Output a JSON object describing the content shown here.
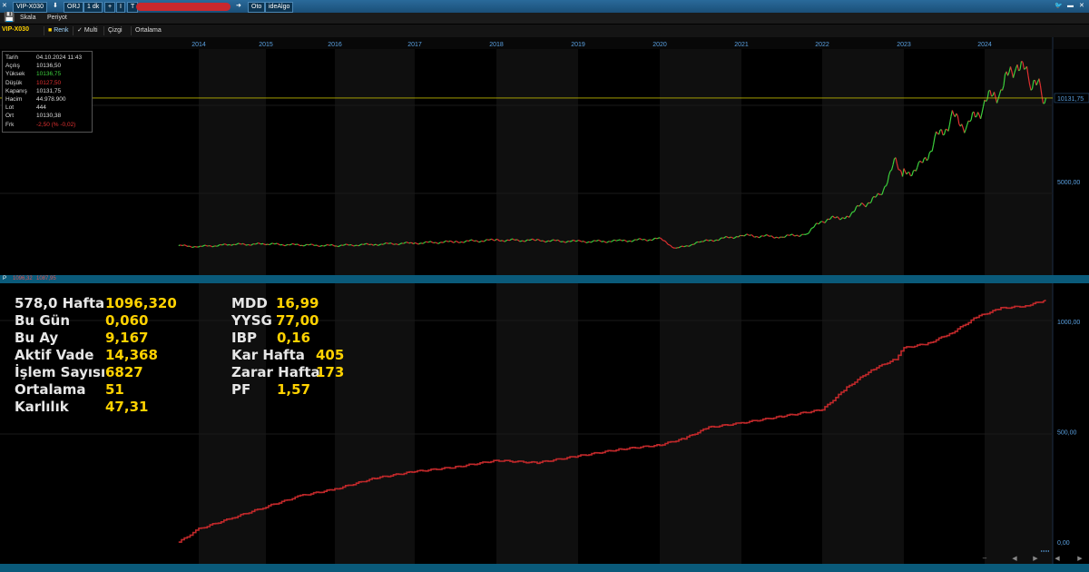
{
  "titlebar": {
    "symbol": "VIP-X030",
    "mode": "ORJ",
    "period": "1 dk",
    "plus": "+",
    "bar": "I",
    "t": "T",
    "auto": "Oto",
    "app": "ideAlgo"
  },
  "toolbar": {
    "scale": "Skala",
    "period": "Periyot"
  },
  "optbar": {
    "symbol": "VIP-X030",
    "color": "Renk",
    "multi": "Multi",
    "line": "Çizgi",
    "average": "Ortalama"
  },
  "colors": {
    "up": "#3ccf3c",
    "down": "#e03030",
    "equity": "#c0282a",
    "lastPrice": "#b8b000",
    "accent": "#0a5a7a"
  },
  "info": {
    "rows": [
      {
        "label": "Tarih",
        "value": "04.10.2024 11:43",
        "color": "#dddddd"
      },
      {
        "label": "Açılış",
        "value": "10136,50",
        "color": "#dddddd"
      },
      {
        "label": "Yüksek",
        "value": "10136,75",
        "color": "#3ccf3c"
      },
      {
        "label": "Düşük",
        "value": "10127,50",
        "color": "#e03030"
      },
      {
        "label": "Kapanış",
        "value": "10131,75",
        "color": "#dddddd"
      },
      {
        "label": "Hacim",
        "value": "44.978.900",
        "color": "#dddddd"
      },
      {
        "label": "Lot",
        "value": "444",
        "color": "#dddddd"
      },
      {
        "label": "Ort",
        "value": "10130,38",
        "color": "#dddddd"
      },
      {
        "label": "Frk",
        "value": "-2,50 (% -0,02)",
        "color": "#e03030"
      }
    ]
  },
  "midstrip": {
    "prefix": "P",
    "v1": "1096,32",
    "v2": "1087,95"
  },
  "stats_left": [
    {
      "label": "578,0 Hafta",
      "value": "1096,320"
    },
    {
      "label": "Bu Gün",
      "value": "0,060"
    },
    {
      "label": "Bu Ay",
      "value": "9,167"
    },
    {
      "label": "Aktif Vade",
      "value": "14,368"
    },
    {
      "label": "İşlem Sayısı",
      "value": "6827"
    },
    {
      "label": "Ortalama",
      "value": "51"
    },
    {
      "label": "Karlılık",
      "value": "47,31"
    }
  ],
  "stats_right": [
    {
      "label": "MDD",
      "value": "16,99"
    },
    {
      "label": "YYSG",
      "value": "77,00"
    },
    {
      "label": "IBP",
      "value": "0,16"
    },
    {
      "label": "Kar Hafta",
      "value": "405"
    },
    {
      "label": "Zarar Hafta",
      "value": "173"
    },
    {
      "label": "PF",
      "value": "1,57"
    }
  ],
  "chart_data": [
    {
      "type": "line",
      "title": "",
      "x_tick_labels": [
        "2014",
        "2015",
        "2016",
        "2017",
        "2018",
        "2019",
        "2020",
        "2021",
        "2022",
        "2023",
        "2024"
      ],
      "y_tick_labels": [
        "5000,00",
        "10131,75"
      ],
      "last_price_label": "10131,75",
      "ylim": [
        0,
        12800
      ],
      "series": [
        {
          "x": [
            2013.7,
            2014.0,
            2014.5,
            2015.0,
            2015.5,
            2016.0,
            2016.5,
            2017.0,
            2017.5,
            2018.0,
            2018.5,
            2019.0,
            2019.5,
            2020.0,
            2020.2,
            2020.5,
            2021.0,
            2021.5,
            2021.8,
            2022.0,
            2022.3,
            2022.5,
            2022.7,
            2022.9,
            2023.0,
            2023.2,
            2023.4,
            2023.6,
            2023.8,
            2024.0,
            2024.2,
            2024.4,
            2024.55,
            2024.7,
            2024.75
          ],
          "values": [
            1080,
            1020,
            1150,
            1180,
            1120,
            1080,
            1160,
            1240,
            1320,
            1420,
            1400,
            1330,
            1360,
            1500,
            900,
            1300,
            1700,
            1620,
            1800,
            2600,
            2900,
            3600,
            4100,
            6200,
            5500,
            5900,
            7600,
            8900,
            8400,
            9800,
            10600,
            12300,
            11200,
            10500,
            10131.75
          ]
        }
      ]
    },
    {
      "type": "line",
      "title": "",
      "y_tick_labels": [
        "0,00",
        "500,00",
        "1000,00"
      ],
      "ylim": [
        -20,
        1140
      ],
      "series": [
        {
          "x": [
            2013.7,
            2014.0,
            2014.5,
            2015.0,
            2015.5,
            2016.0,
            2016.5,
            2017.0,
            2017.5,
            2018.0,
            2018.5,
            2019.0,
            2019.5,
            2020.0,
            2020.3,
            2020.6,
            2021.0,
            2021.5,
            2022.0,
            2022.3,
            2022.6,
            2022.9,
            2023.0,
            2023.3,
            2023.6,
            2023.9,
            2024.2,
            2024.5,
            2024.75
          ],
          "values": [
            0,
            60,
            110,
            160,
            210,
            240,
            290,
            320,
            340,
            370,
            360,
            390,
            420,
            440,
            470,
            520,
            540,
            570,
            600,
            700,
            780,
            830,
            880,
            900,
            950,
            1020,
            1060,
            1070,
            1096.32
          ]
        }
      ]
    }
  ]
}
